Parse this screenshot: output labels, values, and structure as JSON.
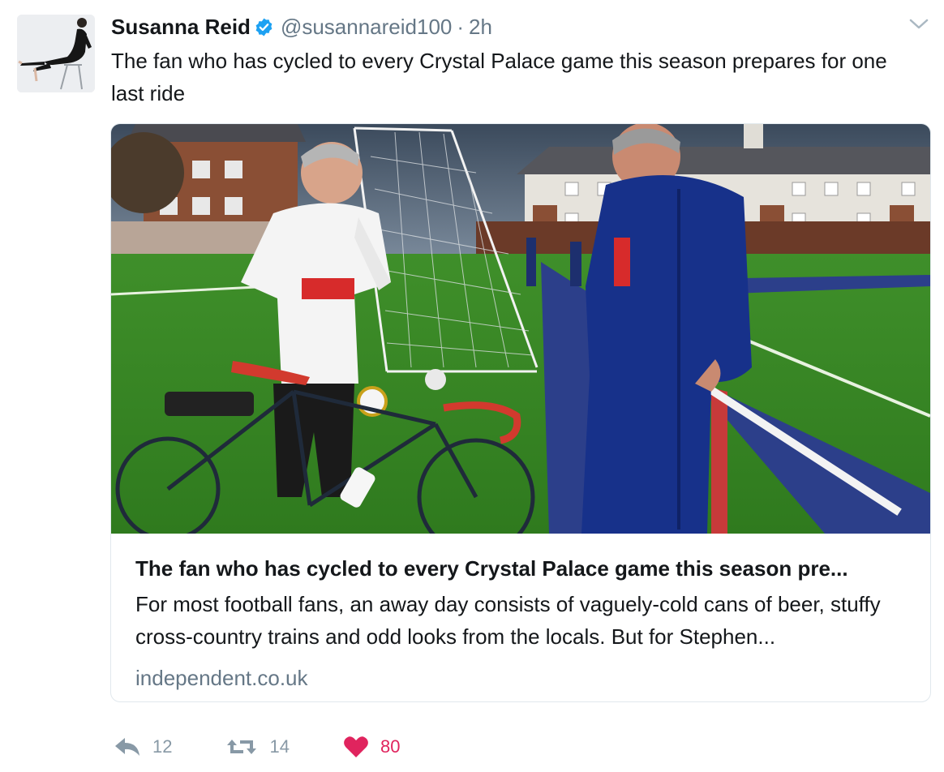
{
  "tweet": {
    "author_name": "Susanna Reid",
    "handle": "@susannareid100",
    "separator": "·",
    "time": "2h",
    "text": "The fan who has cycled to every Crystal Palace game this season prepares for one last ride",
    "verified": true
  },
  "card": {
    "title": "The fan who has cycled to every Crystal Palace game this season pre...",
    "description": "For most football fans, an away day consists of vaguely-cold cans of beer, stuffy cross-country trains and odd looks from the locals. But for Stephen...",
    "domain": "independent.co.uk"
  },
  "actions": {
    "reply_count": "12",
    "retweet_count": "14",
    "like_count": "80"
  },
  "colors": {
    "verified_blue": "#1da1f2",
    "secondary_text": "#657786",
    "action_gray": "#8899a6",
    "like_red": "#e0245e"
  },
  "icons": [
    "verified-badge-icon",
    "chevron-down-icon",
    "reply-icon",
    "retweet-icon",
    "heart-icon"
  ]
}
